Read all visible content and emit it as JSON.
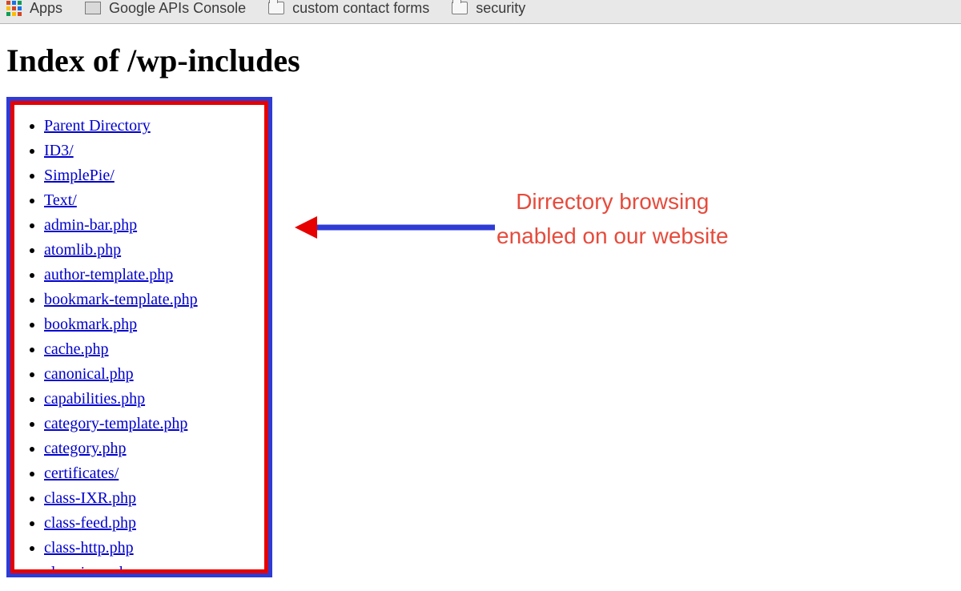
{
  "bookmarks": {
    "apps": "Apps",
    "items": [
      {
        "label": "Google APIs Console",
        "icon": "page"
      },
      {
        "label": "custom contact forms",
        "icon": "folder"
      },
      {
        "label": "security",
        "icon": "folder"
      }
    ]
  },
  "page": {
    "title": "Index of /wp-includes"
  },
  "listing": [
    "Parent Directory",
    "ID3/",
    "SimplePie/",
    "Text/",
    "admin-bar.php",
    "atomlib.php",
    "author-template.php",
    "bookmark-template.php",
    "bookmark.php",
    "cache.php",
    "canonical.php",
    "capabilities.php",
    "category-template.php",
    "category.php",
    "certificates/",
    "class-IXR.php",
    "class-feed.php",
    "class-http.php",
    "class-json.php"
  ],
  "annotation": {
    "line1": "Dirrectory browsing",
    "line2": "enabled on our website"
  },
  "colors": {
    "link": "#0000cc",
    "annotation": "#e64b3c",
    "box_outer": "#2e3bd4",
    "box_inner": "#e60000"
  }
}
